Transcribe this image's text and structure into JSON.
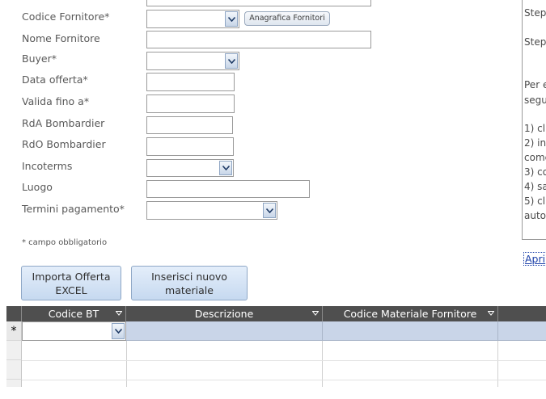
{
  "form": {
    "fields": [
      {
        "label": "Codice Fornitore*",
        "type": "dropdown",
        "value": ""
      },
      {
        "label": "Nome Fornitore",
        "type": "text",
        "value": ""
      },
      {
        "label": "Buyer*",
        "type": "dropdown",
        "value": ""
      },
      {
        "label": "Data offerta*",
        "type": "text",
        "value": ""
      },
      {
        "label": "Valida fino a*",
        "type": "text",
        "value": ""
      },
      {
        "label": "RdA Bombardier",
        "type": "text",
        "value": ""
      },
      {
        "label": "RdO Bombardier",
        "type": "text",
        "value": ""
      },
      {
        "label": "Incoterms",
        "type": "dropdown",
        "value": ""
      },
      {
        "label": "Luogo",
        "type": "text",
        "value": ""
      },
      {
        "label": "Termini pagamento*",
        "type": "dropdown",
        "value": ""
      }
    ],
    "anagrafica_button": "Anagrafica Fornitori",
    "required_note": "* campo obbligatorio"
  },
  "actions": {
    "import_button": "Importa Offerta\nEXCEL",
    "new_material_button": "Inserisci nuovo\nmateriale"
  },
  "right_panel": {
    "lines": [
      "Step",
      "Step",
      "Per e",
      "segu",
      "1) cli",
      "2) ins",
      "comc",
      "3) co",
      "4) sa",
      "5) cli",
      "auto"
    ],
    "link": "Apri"
  },
  "grid": {
    "columns": [
      "Codice BT",
      "Descrizione",
      "Codice Materiale Fornitore"
    ],
    "new_row_marker": "*"
  },
  "colors": {
    "header_bg": "#4f4f4f",
    "selected_row": "#c9d5e8",
    "button_top": "#e4eefa",
    "button_bottom": "#c6d9f0"
  }
}
